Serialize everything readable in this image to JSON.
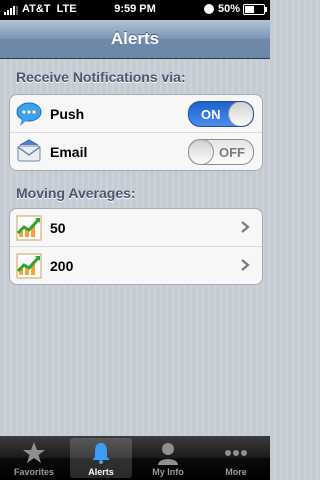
{
  "status_bar": {
    "carrier": "AT&T",
    "network": "LTE",
    "time": "9:59 PM",
    "battery": "50%"
  },
  "nav": {
    "title": "Alerts"
  },
  "notifications": {
    "header": "Receive Notifications via:",
    "items": [
      {
        "label": "Push",
        "icon": "speech-bubble-icon",
        "state": "ON"
      },
      {
        "label": "Email",
        "icon": "envelope-icon",
        "state": "OFF"
      }
    ]
  },
  "moving_averages": {
    "header": "Moving Averages:",
    "items": [
      {
        "label": "50",
        "icon": "chart-trend-icon"
      },
      {
        "label": "200",
        "icon": "chart-trend-icon"
      }
    ]
  },
  "tabs": [
    {
      "label": "Favorites",
      "icon": "star-icon",
      "active": false
    },
    {
      "label": "Alerts",
      "icon": "bell-icon",
      "active": true
    },
    {
      "label": "My Info",
      "icon": "person-icon",
      "active": false
    },
    {
      "label": "More",
      "icon": "ellipsis-icon",
      "active": false
    }
  ],
  "colors": {
    "toggle_on": "#2f74de",
    "nav_bar": "#7b94b4",
    "background": "#c5ccd4"
  }
}
